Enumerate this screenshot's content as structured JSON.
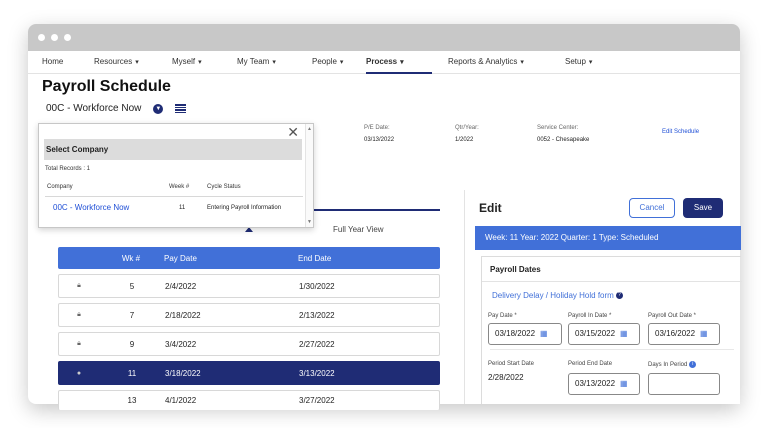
{
  "nav": {
    "home": "Home",
    "resources": "Resources",
    "myself": "Myself",
    "my_team": "My Team",
    "people": "People",
    "process": "Process",
    "reports": "Reports & Analytics",
    "setup": "Setup"
  },
  "page": {
    "title": "Payroll Schedule",
    "company": "00C - Workforce Now"
  },
  "info": {
    "pe_date_label": "P/E Date:",
    "pe_date_value": "03/13/2022",
    "qtr_year_label": "Qtr/Year:",
    "qtr_year_value": "1/2022",
    "service_center_label": "Service Center:",
    "service_center_value": "0052 - Chesapeake",
    "edit_schedule": "Edit Schedule"
  },
  "popup": {
    "title": "Select Company",
    "total_records": "Total Records : 1",
    "col_company": "Company",
    "col_week": "Week #",
    "col_status": "Cycle Status",
    "row": {
      "company": "00C - Workforce Now",
      "week": "11",
      "status": "Entering Payroll Information"
    }
  },
  "tabs": {
    "full_year": "Full Year View"
  },
  "schedule": {
    "headers": {
      "wk": "Wk #",
      "pay": "Pay Date",
      "end": "End Date"
    },
    "rows": [
      {
        "wk": "5",
        "pay": "2/4/2022",
        "end": "1/30/2022"
      },
      {
        "wk": "7",
        "pay": "2/18/2022",
        "end": "2/13/2022"
      },
      {
        "wk": "9",
        "pay": "3/4/2022",
        "end": "2/27/2022"
      },
      {
        "wk": "11",
        "pay": "3/18/2022",
        "end": "3/13/2022"
      },
      {
        "wk": "13",
        "pay": "4/1/2022",
        "end": "3/27/2022"
      }
    ]
  },
  "edit": {
    "title": "Edit",
    "cancel": "Cancel",
    "save": "Save",
    "banner": "Week: 11   Year: 2022   Quarter: 1   Type: Scheduled",
    "section_title": "Payroll Dates",
    "delivery_link": "Delivery Delay / Holiday Hold form",
    "pay_date_label": "Pay Date *",
    "pay_date_value": "03/18/2022",
    "payroll_in_label": "Payroll In Date *",
    "payroll_in_value": "03/15/2022",
    "payroll_out_label": "Payroll Out Date *",
    "payroll_out_value": "03/16/2022",
    "period_start_label": "Period Start Date",
    "period_start_value": "2/28/2022",
    "period_end_label": "Period End Date",
    "period_end_value": "03/13/2022",
    "days_in_period_label": "Days In Period",
    "days_in_period_value": ""
  },
  "colors": {
    "navy": "#1f2c75",
    "blue": "#4170d8"
  }
}
